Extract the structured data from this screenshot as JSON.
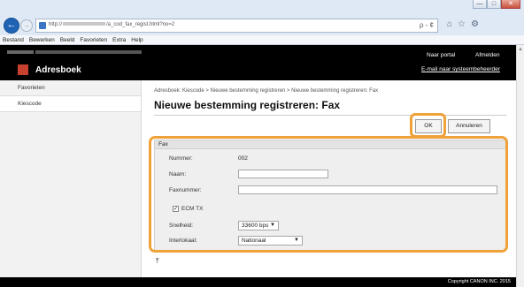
{
  "browser": {
    "url_prefix": "http://",
    "url_suffix": "/a_cod_fax_regist.html?no=2",
    "url_tools": "ρ - ¢",
    "window_buttons": [
      "—",
      "□",
      "✕"
    ],
    "menu": [
      "Bestand",
      "Bewerken",
      "Beeld",
      "Favorieten",
      "Extra",
      "Help"
    ]
  },
  "header": {
    "app_title": "Adresboek",
    "portal_link": "Naar portal",
    "logout_link": "Afmelden",
    "manager_link": "E-mail naar systeembeheerder"
  },
  "sidebar": {
    "items": [
      {
        "label": "Favorieten"
      },
      {
        "label": "Kiescode"
      }
    ]
  },
  "main": {
    "breadcrumb": "Adresboek: Kiescode > Nieuwe bestemming registreren > Nieuwe bestemming registreren: Fax",
    "title": "Nieuwe bestemming registreren: Fax",
    "ok_label": "OK",
    "cancel_label": "Annuleren"
  },
  "form": {
    "section_title": "Fax",
    "number_label": "Nummer:",
    "number_value": "002",
    "name_label": "Naam:",
    "name_value": "",
    "fax_label": "Faxnummer:",
    "fax_value": "",
    "ecm_label": "ECM TX",
    "ecm_checked": true,
    "speed_label": "Snelheid:",
    "speed_value": "33600 bps",
    "line_label": "Interlokaal:",
    "line_value": "Nationaal"
  },
  "footer": {
    "top_icon": "top-jump-icon",
    "copyright": "Copyright CANON INC. 2015"
  },
  "colors": {
    "header_bg": "#000000",
    "highlight": "#f0a23a",
    "app_icon": "#c8412f"
  }
}
